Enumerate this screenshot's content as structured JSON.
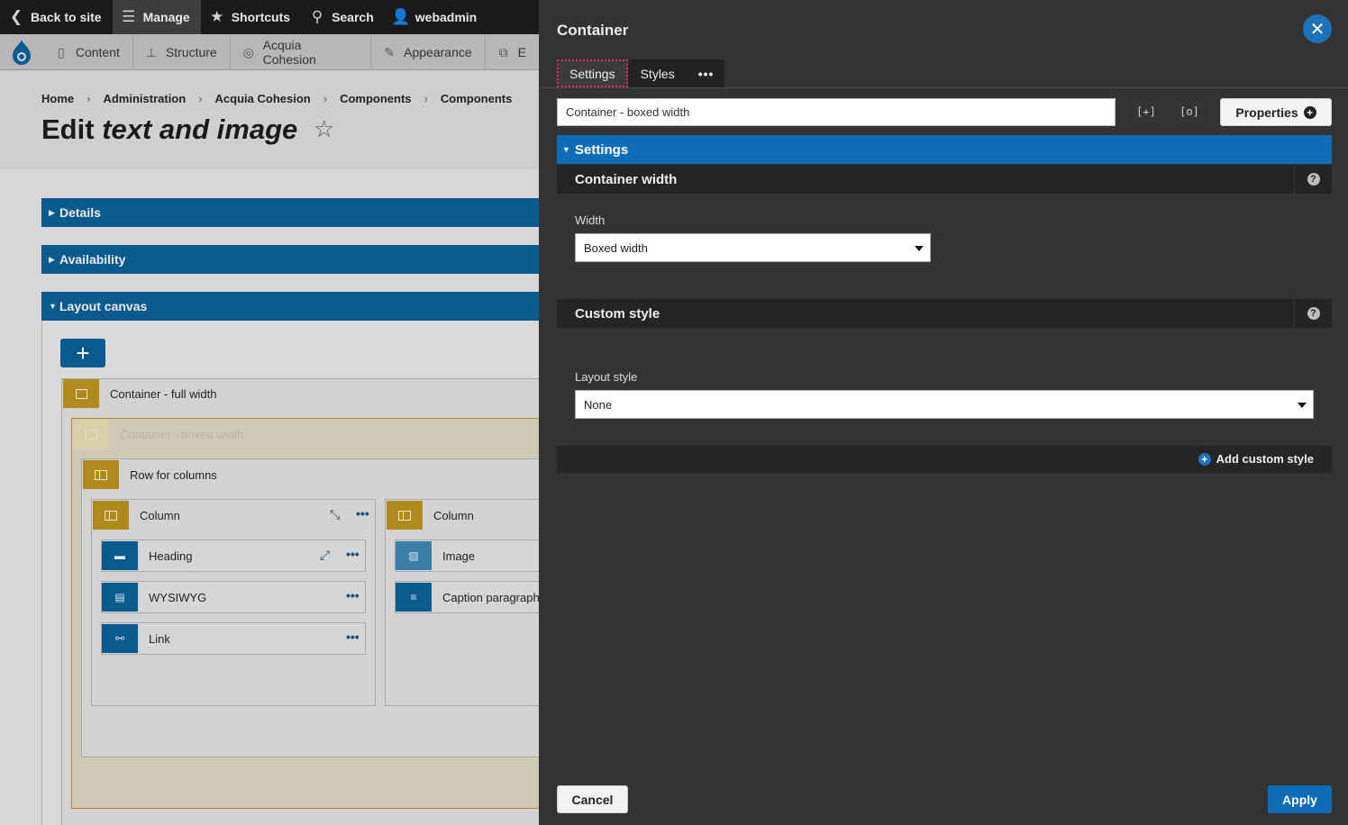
{
  "toolbar": {
    "back_to_site": "Back to site",
    "manage": "Manage",
    "shortcuts": "Shortcuts",
    "search": "Search",
    "user": "webadmin"
  },
  "tray": {
    "content": "Content",
    "structure": "Structure",
    "acquia_cohesion": "Acquia Cohesion",
    "appearance": "Appearance",
    "extend_partial": "E"
  },
  "breadcrumb": [
    "Home",
    "Administration",
    "Acquia Cohesion",
    "Components",
    "Components"
  ],
  "page": {
    "title_prefix": "Edit",
    "title_em": "text and image"
  },
  "accordions": {
    "details": "Details",
    "availability": "Availability",
    "layout_canvas": "Layout canvas"
  },
  "canvas": {
    "add": "+",
    "container_full": "Container - full width",
    "container_boxed": "Container - boxed width",
    "row": "Row for columns",
    "column1": "Column",
    "column2": "Column",
    "heading": "Heading",
    "wysiwyg": "WYSIWYG",
    "link": "Link",
    "image": "Image",
    "caption": "Caption paragraph"
  },
  "modal": {
    "title": "Container",
    "tabs": [
      "Settings",
      "Styles",
      "•••"
    ],
    "title_input_value": "Container - boxed width",
    "props_button": "Properties",
    "settings_header": "Settings",
    "container_width": {
      "header": "Container width",
      "width_label": "Width",
      "width_value": "Boxed width"
    },
    "custom_style": {
      "header": "Custom style",
      "layout_label": "Layout style",
      "layout_value": "None"
    },
    "add_custom_style": "Add custom style",
    "cancel": "Cancel",
    "apply": "Apply"
  },
  "colors": {
    "brand_blue": "#0f6cb6",
    "tab_focus_outline": "#e0257a",
    "component_yellow": "#b08a1c"
  }
}
